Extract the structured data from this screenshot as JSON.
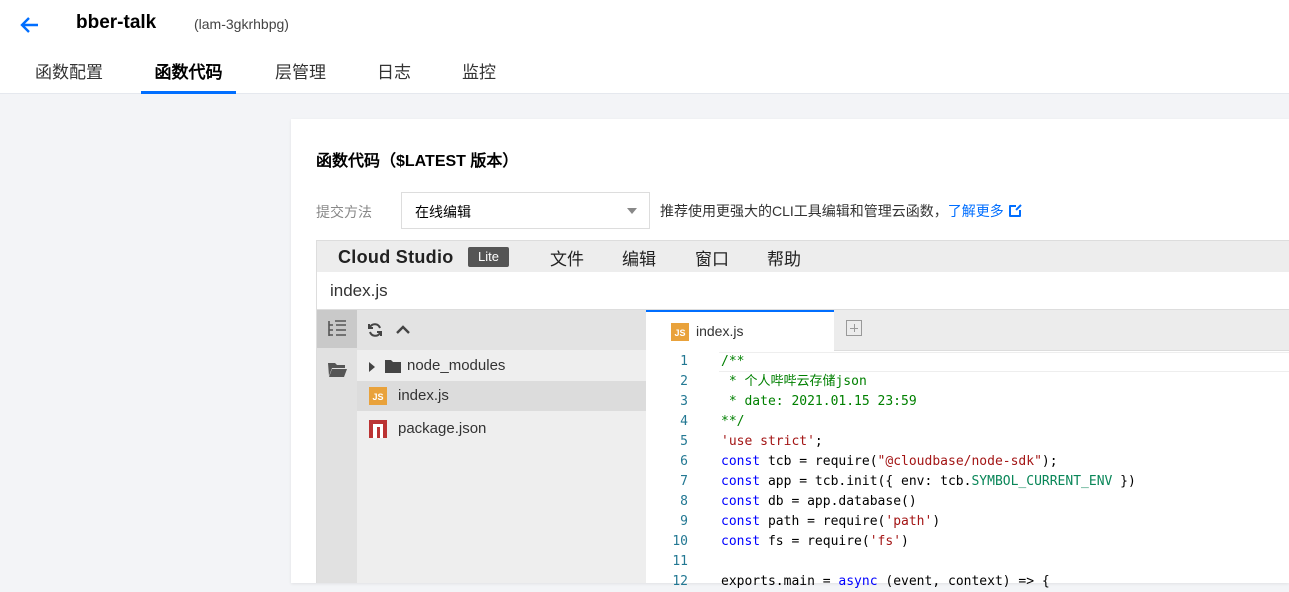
{
  "header": {
    "function_name": "bber-talk",
    "function_id": "(lam-3gkrhbpg)"
  },
  "tabs": [
    {
      "label": "函数配置"
    },
    {
      "label": "函数代码"
    },
    {
      "label": "层管理"
    },
    {
      "label": "日志"
    },
    {
      "label": "监控"
    }
  ],
  "active_tab": "函数代码",
  "panel": {
    "title": "函数代码（$LATEST 版本）",
    "submit_label": "提交方法",
    "submit_value": "在线编辑",
    "hint": "推荐使用更强大的CLI工具编辑和管理云函数，",
    "learn_more": "了解更多"
  },
  "studio": {
    "logo": "Cloud Studio",
    "badge": "Lite",
    "menus": [
      "文件",
      "编辑",
      "窗口",
      "帮助"
    ],
    "file_title": "index.js",
    "tree": [
      {
        "label": "node_modules",
        "type": "folder"
      },
      {
        "label": "index.js",
        "type": "js"
      },
      {
        "label": "package.json",
        "type": "json"
      }
    ],
    "editor_tab": "index.js",
    "js_icon_text": "JS"
  },
  "code_lines": [
    {
      "n": "1"
    },
    {
      "n": "2"
    },
    {
      "n": "3"
    },
    {
      "n": "4"
    },
    {
      "n": "5"
    },
    {
      "n": "6"
    },
    {
      "n": "7"
    },
    {
      "n": "8"
    },
    {
      "n": "9"
    },
    {
      "n": "10"
    },
    {
      "n": "11"
    },
    {
      "n": "12"
    }
  ],
  "code": {
    "l1": "/**",
    "l2": " * 个人哔哔云存储json",
    "l3": " * date: 2021.01.15 23:59",
    "l4": "**/",
    "l5": "'use strict'",
    "l5b": ";",
    "const": "const",
    "l6a": " tcb = require(",
    "l6s": "\"@cloudbase/node-sdk\"",
    "l6b": ");",
    "l7a": " app = tcb.init({ env: tcb.",
    "l7c": "SYMBOL_CURRENT_ENV",
    "l7b": " })",
    "l8a": " db = app.database()",
    "l9a": " path = require(",
    "l9s": "'path'",
    "l9b": ")",
    "l10a": " fs = require(",
    "l10s": "'fs'",
    "l10b": ")",
    "l12a": "exports.main = ",
    "l12k": "async",
    "l12b": " (event, context) => {"
  }
}
